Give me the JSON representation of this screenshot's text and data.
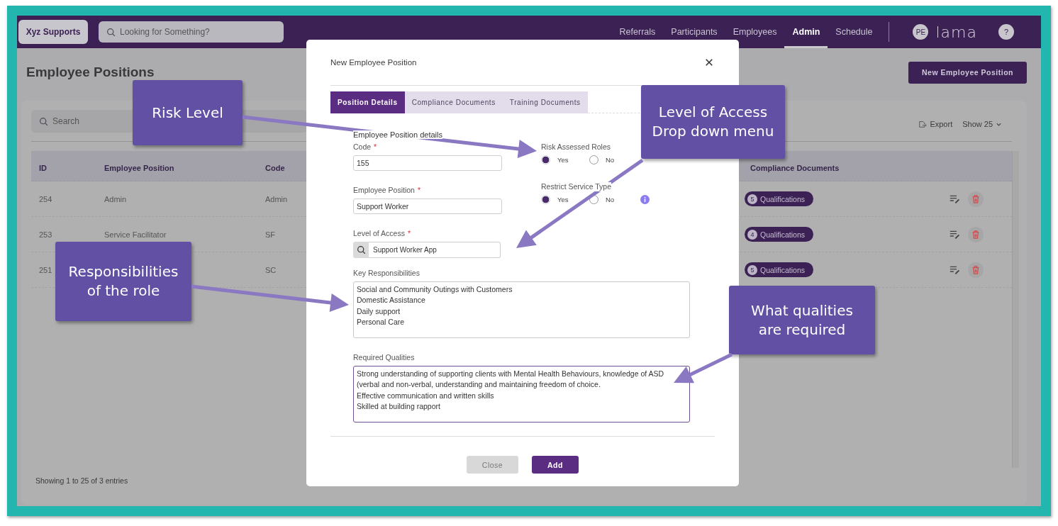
{
  "topbar": {
    "brand": "Xyz Supports",
    "search": {
      "placeholder": "Looking for Something?"
    },
    "nav": [
      {
        "label": "Referrals",
        "selected": false
      },
      {
        "label": "Participants",
        "selected": false
      },
      {
        "label": "Employees",
        "selected": false
      },
      {
        "label": "Admin",
        "selected": true
      },
      {
        "label": "Schedule",
        "selected": false
      }
    ],
    "avatar": "PE",
    "logo": "lama",
    "help": "?"
  },
  "page": {
    "title": "Employee Positions",
    "new_button": "New Employee Position",
    "search": {
      "placeholder": "Search"
    },
    "export": "Export",
    "show": "Show 25",
    "columns": [
      "ID",
      "Employee Position",
      "Code",
      "Compliance Documents"
    ],
    "rows": [
      {
        "id": "254",
        "position": "Admin",
        "code": "Admin",
        "count": "5",
        "badge": "Qualifications"
      },
      {
        "id": "253",
        "position": "Service Facilitator",
        "code": "SF",
        "count": "4",
        "badge": "Qualifications"
      },
      {
        "id": "251",
        "code": "SC",
        "count": "5",
        "badge": "Qualifications"
      }
    ],
    "footer": "Showing 1 to 25 of 3 entries"
  },
  "modal": {
    "title": "New Employee Position",
    "tabs": [
      {
        "label": "Position Details",
        "selected": true
      },
      {
        "label": "Compliance Documents",
        "selected": false
      },
      {
        "label": "Training Documents",
        "selected": false
      }
    ],
    "section": "Employee Position details",
    "fields": [
      {
        "label": "Code",
        "required_mark": "*",
        "value": "155"
      },
      {
        "label": "Employee Position",
        "required_mark": "*",
        "value": "Support Worker"
      },
      {
        "label": "Level of Access",
        "required_mark": "*",
        "value": "Support Worker App",
        "kind": "search"
      }
    ],
    "radio_groups": [
      {
        "label": "Risk Assessed Roles",
        "options": [
          {
            "label": "Yes",
            "selected": true
          },
          {
            "label": "No",
            "selected": false
          }
        ]
      },
      {
        "label": "Restrict Service Type",
        "info": true,
        "options": [
          {
            "label": "Yes",
            "selected": true
          },
          {
            "label": "No",
            "selected": false
          }
        ]
      }
    ],
    "text_areas": [
      {
        "label": "Key Responsibilities",
        "focused": false,
        "value": "Social and Community Outings with Customers\nDomestic Assistance\nDaily support\nPersonal Care"
      },
      {
        "label": "Required Qualities",
        "focused": true,
        "value": "Strong understanding of supporting clients with Mental Health Behaviours, knowledge of ASD\n(verbal and non-verbal, understanding and maintaining freedom of choice.\nEffective communication and written skills\nSkilled at building rapport"
      }
    ],
    "buttons": [
      {
        "label": "Close",
        "kind": "secondary"
      },
      {
        "label": "Add",
        "kind": "primary"
      }
    ]
  },
  "callouts": [
    {
      "text": "Risk Level"
    },
    {
      "text": "Level of Access\nDrop down menu"
    },
    {
      "text": "Responsibilities\nof the role"
    },
    {
      "text": "What qualities\nare required"
    }
  ]
}
